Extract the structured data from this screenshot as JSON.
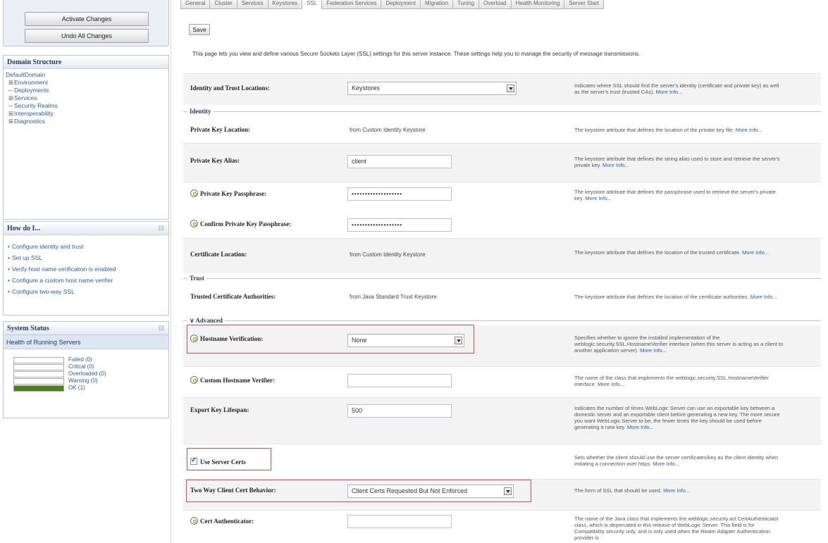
{
  "change_center": {
    "activate": "Activate Changes",
    "undo": "Undo All Changes"
  },
  "domain_structure": {
    "title": "Domain Structure",
    "root": "DefaultDomain",
    "items": [
      {
        "label": "Environment",
        "expander": "⊞"
      },
      {
        "label": "Deployments",
        "expander": "─"
      },
      {
        "label": "Services",
        "expander": "⊞"
      },
      {
        "label": "Security Realms",
        "expander": "─"
      },
      {
        "label": "Interoperability",
        "expander": "⊞"
      },
      {
        "label": "Diagnostics",
        "expander": "⊞"
      }
    ]
  },
  "how_do_i": {
    "title": "How do I...",
    "items": [
      "Configure identity and trust",
      "Set up SSL",
      "Verify host name verification is enabled",
      "Configure a custom host name verifier",
      "Configure two-way SSL"
    ]
  },
  "system_status": {
    "title": "System Status",
    "health_title": "Health of Running Servers",
    "rows": [
      {
        "label": "Failed (0)",
        "level": 0
      },
      {
        "label": "Critical (0)",
        "level": 0
      },
      {
        "label": "Overloaded (0)",
        "level": 0
      },
      {
        "label": "Warning (0)",
        "level": 0
      },
      {
        "label": "OK (1)",
        "level": 1
      }
    ],
    "ok_color": "#4f7f1c"
  },
  "tabs": [
    "General",
    "Cluster",
    "Services",
    "Keystores",
    "SSL",
    "Federation Services",
    "Deployment",
    "Migration",
    "Tuning",
    "Overload",
    "Health Monitoring",
    "Server Start"
  ],
  "active_tab": "SSL",
  "save_label": "Save",
  "intro": "This page lets you view and define various Secure Sockets Layer (SSL) settings for this server instance. These settings help you to manage the security of message transmissions.",
  "fields": {
    "identity_trust": {
      "label": "Identity and Trust Locations:",
      "value": "Keystores",
      "desc": "Indicates where SSL should find the server's identity (certificate and private key) as well as the server's trust (trusted CAs).",
      "more": "More Info..."
    },
    "identity_section": "Identity",
    "pk_location": {
      "label": "Private Key Location:",
      "value": "from Custom Identity Keystore",
      "desc": "The keystore attribute that defines the location of the private key file.",
      "more": "More Info..."
    },
    "pk_alias": {
      "label": "Private Key Alias:",
      "value": "client",
      "desc": "The keystore attribute that defines the string alias used to store and retrieve the server's private key.",
      "more": "More Info..."
    },
    "pk_pass": {
      "label": "Private Key Passphrase:",
      "value": "•••••••••••••••••••",
      "desc": "The keystore attribute that defines the passphrase used to retrieve the server's private key.",
      "more": "More Info..."
    },
    "pk_pass_confirm": {
      "label": "Confirm Private Key Passphrase:",
      "value": "•••••••••••••••••••"
    },
    "cert_location": {
      "label": "Certificate Location:",
      "value": "from Custom Identity Keystore",
      "desc": "The keystore attribute that defines the location of the trusted certificate.",
      "more": "More Info..."
    },
    "trust_section": "Trust",
    "trusted_ca": {
      "label": "Trusted Certificate Authorities:",
      "value": "from Java Standard Trust Keystore",
      "desc": "The keystore attribute that defines the location of the certificate authorities.",
      "more": "More Info..."
    },
    "advanced_section": "∨ Advanced",
    "hostname_verification": {
      "label": "Hostname Verification:",
      "value": "None",
      "desc": "Specifies whether to ignore the installed implementation of the weblogic.security.SSL.HostnameVerifier interface (when this server is acting as a client to another application server).",
      "more": "More Info..."
    },
    "custom_verifier": {
      "label": "Custom Hostname Verifier:",
      "value": "",
      "desc": "The name of the class that implements the weblogic.security.SSL.HostnameVerifier interface.",
      "more": "More Info..."
    },
    "export_key": {
      "label": "Export Key Lifespan:",
      "value": "500",
      "desc": "Indicates the number of times WebLogic Server can use an exportable key between a domestic server and an exportable client before generating a new key. The more secure you want WebLogic Server to be, the fewer times the key should be used before generating a new key.",
      "more": "More Info..."
    },
    "use_server_certs": {
      "label": "Use Server Certs",
      "checked": true,
      "desc": "Sets whether the client should use the server certificates/key as the client identity when initiating a connection over https.",
      "more": "More Info..."
    },
    "two_way": {
      "label": "Two Way Client Cert Behavior:",
      "value": "Client Certs Requested But Not Enforced",
      "desc": "The form of SSL that should be used.",
      "more": "More Info..."
    },
    "cert_authenticator": {
      "label": "Cert Authenticator:",
      "value": "",
      "desc": "The name of the Java class that implements the weblogic.security.acl.CertAuthenticator class, which is deprecated in this release of WebLogic Server. This field is for Compatibility security only, and is only used when the Realm Adapter Authentication provider is"
    }
  },
  "highlight_color": "#e0494b"
}
